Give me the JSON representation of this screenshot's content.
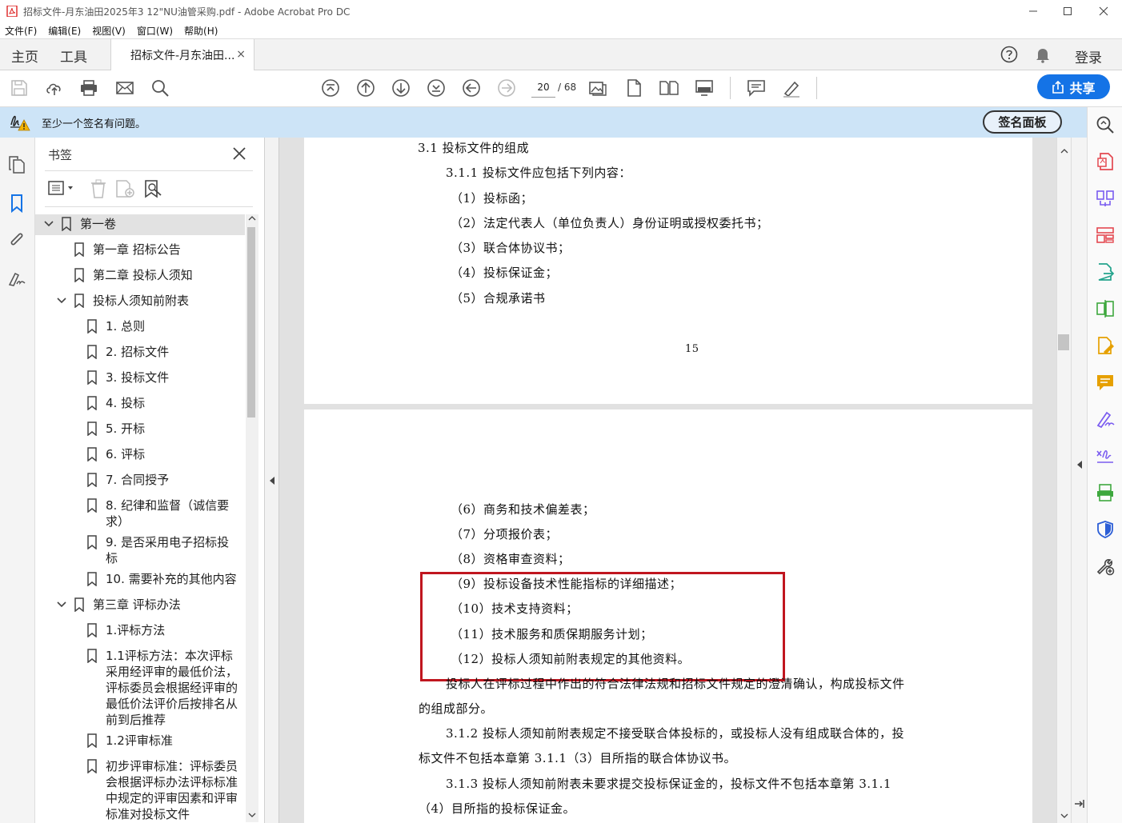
{
  "window": {
    "title": "招标文件-月东油田2025年3 12\"NU油管采购.pdf - Adobe Acrobat Pro DC"
  },
  "menu": [
    "文件(F)",
    "编辑(E)",
    "视图(V)",
    "窗口(W)",
    "帮助(H)"
  ],
  "tabs": {
    "home": "主页",
    "tools": "工具",
    "document": "招标文件-月东油田...",
    "close": "×",
    "login": "登录"
  },
  "toolbar": {
    "current_page": "20",
    "total_pages": "/ 68",
    "share_label": "共享"
  },
  "signature": {
    "message": "至少一个签名有问题。",
    "panel_button": "签名面板"
  },
  "bookmarks": {
    "title": "书签",
    "items": [
      {
        "label": "第一卷",
        "level": 0,
        "expanded": true,
        "selected": true
      },
      {
        "label": "第一章  招标公告",
        "level": 1
      },
      {
        "label": "第二章  投标人须知",
        "level": 1
      },
      {
        "label": "投标人须知前附表",
        "level": 1,
        "expanded": true
      },
      {
        "label": "1. 总则",
        "level": 2
      },
      {
        "label": "2. 招标文件",
        "level": 2
      },
      {
        "label": "3. 投标文件",
        "level": 2
      },
      {
        "label": "4. 投标",
        "level": 2
      },
      {
        "label": "5. 开标",
        "level": 2
      },
      {
        "label": "6. 评标",
        "level": 2
      },
      {
        "label": "7. 合同授予",
        "level": 2
      },
      {
        "label": "8. 纪律和监督（诚信要求）",
        "level": 2
      },
      {
        "label": "9. 是否采用电子招标投标",
        "level": 2
      },
      {
        "label": "10. 需要补充的其他内容",
        "level": 2
      },
      {
        "label": "第三章  评标办法",
        "level": 1,
        "expanded": true
      },
      {
        "label": "1.评标方法",
        "level": 2
      },
      {
        "label": "1.1评标方法：本次评标采用经评审的最低价法，评标委员会根据经评审的最低价法评价后按排名从前到后推荐",
        "level": 2
      },
      {
        "label": "1.2评审标准",
        "level": 2
      },
      {
        "label": "初步评审标准：评标委员会根据评标办法评标标准中规定的评审因素和评审标准对投标文件",
        "level": 2
      }
    ]
  },
  "document": {
    "page1_lines": [
      "3.1  投标文件的组成",
      "3.1.1  投标文件应包括下列内容：",
      "（1）投标函；",
      "（2）法定代表人（单位负责人）身份证明或授权委托书；",
      "（3）联合体协议书；",
      "（4）投标保证金；",
      "（5）合规承诺书"
    ],
    "page_number": "15",
    "page2_lines": [
      "（6）商务和技术偏差表；",
      "（7）分项报价表；",
      "（8）资格审查资料；",
      "（9）投标设备技术性能指标的详细描述；",
      "（10）技术支持资料；",
      "（11）技术服务和质保期服务计划；",
      "（12）投标人须知前附表规定的其他资料。",
      "投标人在评标过程中作出的符合法律法规和招标文件规定的澄清确认，构成投标文件",
      "的组成部分。",
      "3.1.2  投标人须知前附表规定不接受联合体投标的，或投标人没有组成联合体的，投",
      "标文件不包括本章第 3.1.1（3）目所指的联合体协议书。",
      "3.1.3  投标人须知前附表未要求提交投标保证金的，投标文件不包括本章第 3.1.1",
      "（4）目所指的投标保证金。"
    ]
  },
  "colors": {
    "accent": "#1473e6",
    "banner": "#cde4f7",
    "highlight_box": "#c0161f"
  }
}
